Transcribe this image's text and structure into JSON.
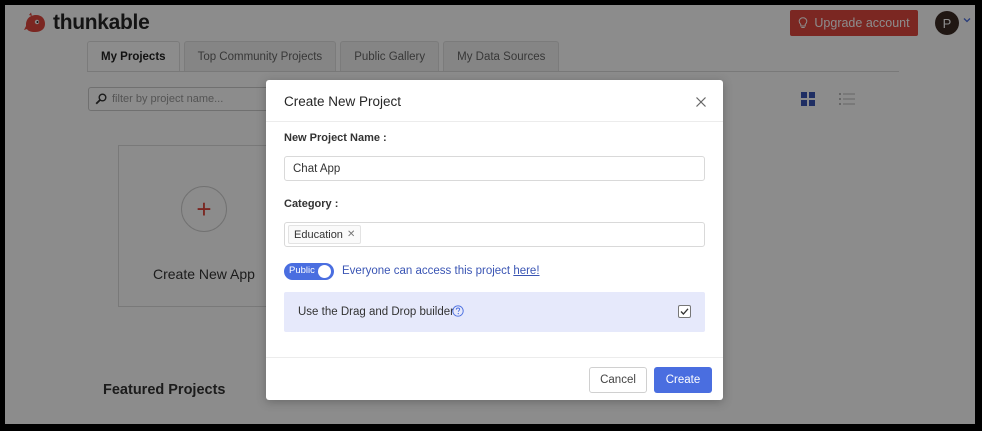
{
  "app": {
    "brand": "thunkable",
    "upgrade_label": "Upgrade account",
    "avatar_initial": "P"
  },
  "tabs": [
    {
      "label": "My Projects",
      "active": true
    },
    {
      "label": "Top Community Projects",
      "active": false
    },
    {
      "label": "Public Gallery",
      "active": false
    },
    {
      "label": "My Data Sources",
      "active": false
    }
  ],
  "filter": {
    "placeholder": "filter by project name..."
  },
  "main": {
    "create_card_label": "Create New App",
    "featured_heading": "Featured Projects"
  },
  "modal": {
    "title": "Create New Project",
    "name_label": "New Project Name",
    "name_value": "Chat App",
    "category_label": "Category",
    "category_chip": "Education",
    "toggle_label": "Public",
    "access_text": "Everyone can access this project",
    "access_link": "here!",
    "dnd_label": "Use the Drag and Drop builder",
    "dnd_checked": true,
    "cancel_label": "Cancel",
    "create_label": "Create"
  },
  "colors": {
    "brand_red": "#e0483e",
    "accent_blue": "#4a6ee0",
    "panel_blue": "#e6e9fb"
  },
  "icons": [
    "logo-mark-icon",
    "lightbulb-icon",
    "chevron-down-icon",
    "search-icon",
    "grid-view-icon",
    "list-view-icon",
    "plus-icon",
    "close-icon",
    "help-icon",
    "check-icon"
  ]
}
